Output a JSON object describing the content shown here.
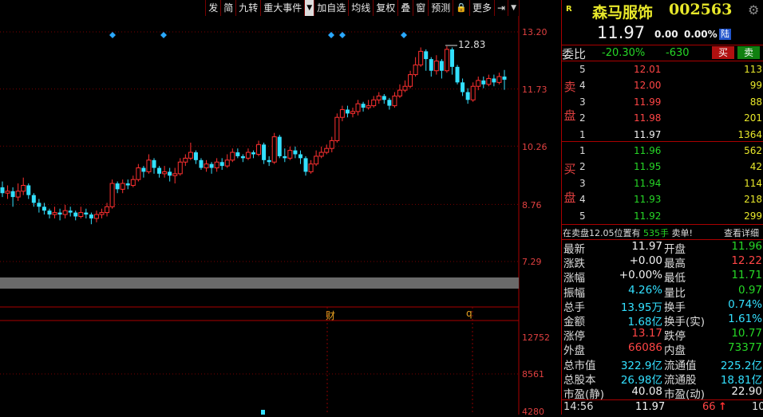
{
  "toolbar": {
    "items": [
      {
        "label": "发",
        "arrow": false
      },
      {
        "label": "简",
        "arrow": false
      },
      {
        "label": "九转",
        "arrow": false
      },
      {
        "label": "重大事件",
        "arrow": false
      },
      {
        "label": "▼",
        "arrow": true
      },
      {
        "label": "加自选",
        "arrow": false
      },
      {
        "label": "均线",
        "arrow": false
      },
      {
        "label": "复权",
        "arrow": false
      },
      {
        "label": "叠",
        "arrow": false
      },
      {
        "label": "窗",
        "arrow": false
      },
      {
        "label": "预测",
        "arrow": false
      },
      {
        "label": "🔒",
        "arrow": false
      },
      {
        "label": "更多",
        "arrow": false
      },
      {
        "label": "⇥",
        "arrow": false
      },
      {
        "label": "▼",
        "arrow": true
      }
    ]
  },
  "chart": {
    "price_axis": [
      "13.20",
      "11.73",
      "10.26",
      "8.76",
      "7.29"
    ],
    "volume_axis": [
      "12752",
      "8561",
      "4280"
    ],
    "max_label": "12.83",
    "event_markers": [
      "财",
      "q"
    ],
    "colors": {
      "up": "#ff3030",
      "down": "#33e0ff",
      "grid": "#7a0000",
      "diamond": "#2aa8ff"
    }
  },
  "chart_data": {
    "type": "candlestick",
    "ylim": [
      6.8,
      13.6
    ],
    "candles": [
      [
        9.2,
        9.05,
        9.35,
        8.95
      ],
      [
        9.05,
        9.1,
        9.25,
        8.9
      ],
      [
        9.1,
        8.95,
        9.2,
        8.7
      ],
      [
        8.95,
        9.1,
        9.3,
        8.85
      ],
      [
        9.1,
        9.25,
        9.45,
        9.0
      ],
      [
        9.25,
        9.0,
        9.3,
        8.9
      ],
      [
        9.0,
        8.8,
        9.05,
        8.7
      ],
      [
        8.8,
        8.7,
        8.9,
        8.55
      ],
      [
        8.7,
        8.6,
        8.8,
        8.5
      ],
      [
        8.6,
        8.5,
        8.65,
        8.4
      ],
      [
        8.5,
        8.55,
        8.7,
        8.4
      ],
      [
        8.55,
        8.5,
        8.65,
        8.35
      ],
      [
        8.5,
        8.6,
        8.75,
        8.4
      ],
      [
        8.6,
        8.55,
        8.7,
        8.45
      ],
      [
        8.55,
        8.45,
        8.6,
        8.35
      ],
      [
        8.45,
        8.55,
        8.7,
        8.4
      ],
      [
        8.55,
        8.5,
        8.65,
        8.4
      ],
      [
        8.5,
        8.4,
        8.55,
        8.25
      ],
      [
        8.4,
        8.5,
        8.6,
        8.3
      ],
      [
        8.5,
        8.55,
        8.65,
        8.4
      ],
      [
        8.55,
        8.7,
        8.8,
        8.45
      ],
      [
        8.7,
        9.3,
        9.4,
        8.65
      ],
      [
        9.3,
        9.15,
        9.35,
        9.05
      ],
      [
        9.15,
        9.3,
        9.4,
        9.05
      ],
      [
        9.3,
        9.25,
        9.4,
        9.15
      ],
      [
        9.25,
        9.4,
        9.5,
        9.2
      ],
      [
        9.4,
        9.7,
        9.8,
        9.35
      ],
      [
        9.7,
        9.6,
        9.75,
        9.45
      ],
      [
        9.6,
        9.9,
        10.05,
        9.55
      ],
      [
        9.9,
        9.7,
        9.95,
        9.55
      ],
      [
        9.7,
        9.55,
        9.75,
        9.45
      ],
      [
        9.55,
        9.6,
        9.75,
        9.45
      ],
      [
        9.6,
        9.5,
        9.7,
        9.35
      ],
      [
        9.5,
        9.55,
        9.7,
        9.3
      ],
      [
        9.55,
        9.85,
        9.95,
        9.5
      ],
      [
        9.85,
        9.95,
        10.05,
        9.75
      ],
      [
        9.95,
        10.1,
        10.35,
        9.9
      ],
      [
        10.1,
        9.9,
        10.15,
        9.8
      ],
      [
        9.9,
        9.7,
        9.95,
        9.65
      ],
      [
        9.7,
        9.8,
        9.9,
        9.6
      ],
      [
        9.8,
        9.7,
        9.85,
        9.55
      ],
      [
        9.7,
        9.85,
        9.95,
        9.6
      ],
      [
        9.85,
        9.75,
        9.95,
        9.65
      ],
      [
        9.75,
        9.9,
        10.05,
        9.7
      ],
      [
        9.9,
        10.1,
        10.2,
        9.85
      ],
      [
        10.1,
        10.0,
        10.2,
        9.95
      ],
      [
        10.0,
        9.95,
        10.05,
        9.85
      ],
      [
        9.95,
        10.1,
        10.2,
        9.9
      ],
      [
        10.1,
        10.05,
        10.15,
        9.95
      ],
      [
        10.05,
        10.3,
        10.4,
        10.0
      ],
      [
        10.3,
        9.9,
        10.35,
        9.8
      ],
      [
        9.9,
        9.85,
        10.0,
        9.75
      ],
      [
        9.85,
        10.5,
        10.6,
        9.8
      ],
      [
        10.5,
        10.0,
        10.55,
        9.95
      ],
      [
        10.0,
        9.95,
        10.2,
        9.85
      ],
      [
        9.95,
        10.15,
        10.25,
        9.9
      ],
      [
        10.15,
        10.05,
        10.25,
        9.95
      ],
      [
        10.05,
        9.95,
        10.15,
        9.8
      ],
      [
        9.95,
        9.6,
        10.0,
        9.5
      ],
      [
        9.6,
        9.8,
        9.9,
        9.55
      ],
      [
        9.8,
        10.0,
        10.15,
        9.75
      ],
      [
        10.0,
        10.1,
        10.25,
        9.95
      ],
      [
        10.1,
        10.2,
        10.3,
        10.05
      ],
      [
        10.2,
        10.4,
        10.5,
        10.1
      ],
      [
        10.4,
        11.0,
        11.1,
        10.35
      ],
      [
        11.0,
        11.2,
        11.3,
        10.9
      ],
      [
        11.2,
        11.1,
        11.3,
        11.0
      ],
      [
        11.1,
        11.15,
        11.25,
        11.0
      ],
      [
        11.15,
        11.35,
        11.45,
        11.05
      ],
      [
        11.35,
        11.25,
        11.4,
        11.15
      ],
      [
        11.25,
        11.3,
        11.45,
        11.2
      ],
      [
        11.3,
        11.45,
        11.55,
        11.25
      ],
      [
        11.45,
        11.55,
        11.65,
        11.35
      ],
      [
        11.55,
        11.45,
        11.6,
        11.35
      ],
      [
        11.45,
        11.3,
        11.5,
        11.2
      ],
      [
        11.3,
        11.55,
        11.65,
        11.25
      ],
      [
        11.55,
        11.7,
        11.85,
        11.5
      ],
      [
        11.7,
        11.8,
        11.95,
        11.65
      ],
      [
        11.8,
        12.1,
        12.2,
        11.75
      ],
      [
        12.1,
        12.35,
        12.55,
        12.05
      ],
      [
        12.35,
        12.7,
        12.8,
        12.3
      ],
      [
        12.7,
        12.5,
        12.75,
        12.2
      ],
      [
        12.5,
        12.2,
        12.55,
        12.05
      ],
      [
        12.2,
        12.45,
        12.6,
        12.1
      ],
      [
        12.45,
        12.2,
        12.5,
        12.0
      ],
      [
        12.2,
        12.75,
        12.83,
        12.15
      ],
      [
        12.75,
        12.3,
        12.8,
        12.1
      ],
      [
        12.3,
        11.9,
        12.35,
        11.85
      ],
      [
        11.9,
        11.65,
        12.0,
        11.55
      ],
      [
        11.65,
        11.45,
        11.75,
        11.35
      ],
      [
        11.45,
        11.8,
        11.9,
        11.4
      ],
      [
        11.8,
        11.95,
        12.05,
        11.7
      ],
      [
        11.95,
        11.85,
        12.05,
        11.75
      ],
      [
        11.85,
        12.0,
        12.1,
        11.8
      ],
      [
        12.0,
        11.9,
        12.1,
        11.8
      ],
      [
        11.9,
        12.05,
        12.15,
        11.85
      ],
      [
        12.05,
        11.97,
        12.22,
        11.71
      ]
    ]
  },
  "quote": {
    "badge": "R",
    "name": "森马服饰",
    "code": "002563",
    "price": "11.97",
    "change": "0.00",
    "change_pct": "0.00%",
    "tag": "陆",
    "weibi_label": "委比",
    "weibi_pct": "-20.30%",
    "weicha": "-630",
    "buy_btn": "买",
    "sell_btn": "卖"
  },
  "orderbook": {
    "sell_label": [
      "卖",
      "盘"
    ],
    "buy_label": [
      "买",
      "盘"
    ],
    "sell": [
      {
        "level": "5",
        "price": "12.01",
        "vol": "113",
        "color": "red"
      },
      {
        "level": "4",
        "price": "12.00",
        "vol": "99",
        "color": "red"
      },
      {
        "level": "3",
        "price": "11.99",
        "vol": "88",
        "color": "red"
      },
      {
        "level": "2",
        "price": "11.98",
        "vol": "201",
        "color": "red"
      },
      {
        "level": "1",
        "price": "11.97",
        "vol": "1364",
        "color": "white"
      }
    ],
    "buy": [
      {
        "level": "1",
        "price": "11.96",
        "vol": "562",
        "color": "green"
      },
      {
        "level": "2",
        "price": "11.95",
        "vol": "42",
        "color": "green"
      },
      {
        "level": "3",
        "price": "11.94",
        "vol": "114",
        "color": "green"
      },
      {
        "level": "4",
        "price": "11.93",
        "vol": "218",
        "color": "green"
      },
      {
        "level": "5",
        "price": "11.92",
        "vol": "299",
        "color": "green"
      }
    ],
    "notice_prefix": "在卖盘12.05位置有",
    "notice_vol": "535手",
    "notice_suffix": "卖单!",
    "notice_link": "查看详细"
  },
  "stats": [
    {
      "l": "最新",
      "lv": "11.97",
      "lc": "white",
      "r": "开盘",
      "rv": "11.96",
      "rc": "green"
    },
    {
      "l": "涨跌",
      "lv": "+0.00",
      "lc": "white",
      "r": "最高",
      "rv": "12.22",
      "rc": "red"
    },
    {
      "l": "涨幅",
      "lv": "+0.00%",
      "lc": "white",
      "r": "最低",
      "rv": "11.71",
      "rc": "green"
    },
    {
      "l": "振幅",
      "lv": "4.26%",
      "lc": "cyan",
      "r": "量比",
      "rv": "0.97",
      "rc": "green"
    },
    {
      "l": "总手",
      "lv": "13.95万",
      "lc": "cyan",
      "r": "换手",
      "rv": "0.74%",
      "rc": "cyan"
    },
    {
      "l": "金额",
      "lv": "1.68亿",
      "lc": "cyan",
      "r": "换手(实)",
      "rv": "1.61%",
      "rc": "cyan"
    },
    {
      "l": "涨停",
      "lv": "13.17",
      "lc": "red",
      "r": "跌停",
      "rv": "10.77",
      "rc": "green"
    },
    {
      "l": "外盘",
      "lv": "66086",
      "lc": "red",
      "r": "内盘",
      "rv": "73377",
      "rc": "green"
    },
    {
      "l": "总市值",
      "lv": "322.9亿",
      "lc": "cyan",
      "r": "流通值",
      "rv": "225.2亿",
      "rc": "cyan"
    },
    {
      "l": "总股本",
      "lv": "26.98亿",
      "lc": "cyan",
      "r": "流通股",
      "rv": "18.81亿",
      "rc": "cyan"
    },
    {
      "l": "市盈(静)",
      "lv": "40.08",
      "lc": "white",
      "r": "市盈(动)",
      "rv": "22.90",
      "rc": "white"
    }
  ],
  "tick": {
    "time": "14:56",
    "price": "11.97",
    "vol": "66",
    "arrow": "↑",
    "count": "10"
  }
}
